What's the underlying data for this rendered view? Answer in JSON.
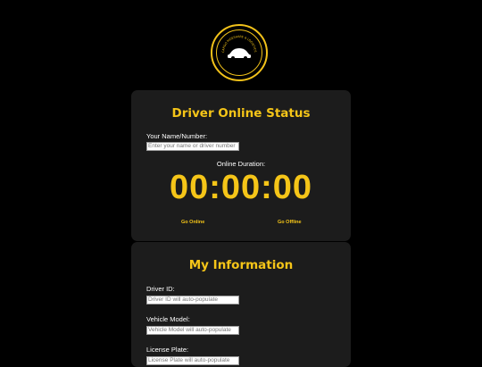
{
  "logo": {
    "name": "logo-badge",
    "arc_text": "CARGO RIDESHARE & LOGISTICS"
  },
  "status_card": {
    "title": "Driver Online Status",
    "name_label": "Your Name/Number:",
    "name_placeholder": "Enter your name or driver number",
    "duration_label": "Online Duration:",
    "timer": "00:00:00",
    "go_online": "Go Online",
    "go_offline": "Go Offline"
  },
  "info_card": {
    "title": "My Information",
    "driver_id_label": "Driver ID:",
    "driver_id_placeholder": "Driver ID will auto-populate",
    "vehicle_model_label": "Vehicle Model:",
    "vehicle_model_placeholder": "Vehicle Model will auto-populate",
    "license_plate_label": "License Plate:",
    "license_plate_placeholder": "License Plate will auto-populate"
  },
  "colors": {
    "accent": "#f5c518",
    "card": "#1c1c1c",
    "background": "#000000"
  }
}
